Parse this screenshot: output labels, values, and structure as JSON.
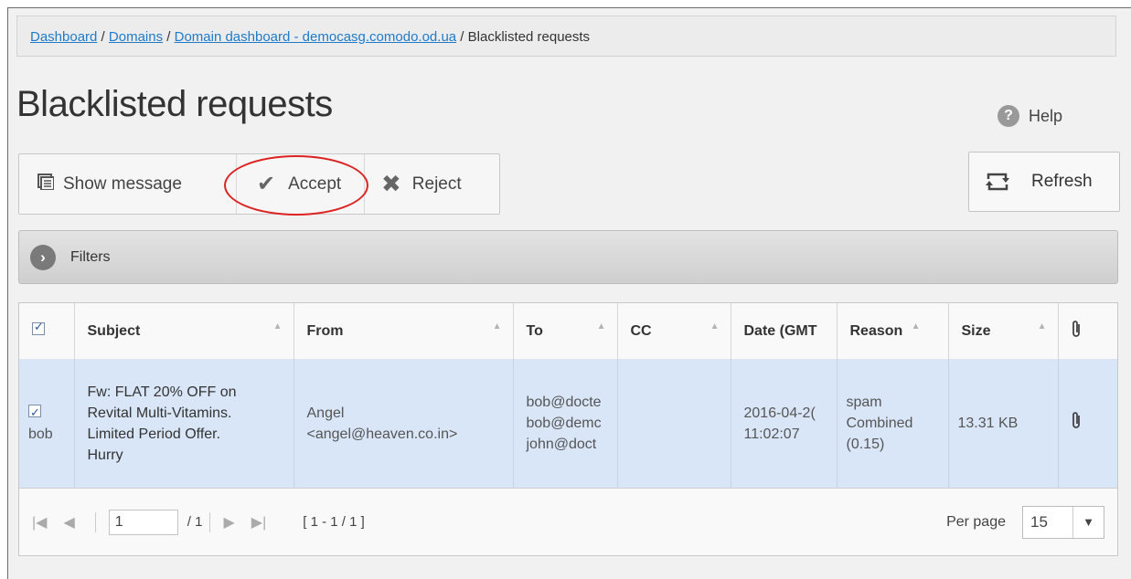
{
  "breadcrumb": {
    "dashboard": "Dashboard",
    "domains": "Domains",
    "domain_dashboard": "Domain dashboard - democasg.comodo.od.ua",
    "current": "Blacklisted requests",
    "separator": " / "
  },
  "page": {
    "title": "Blacklisted requests"
  },
  "help": {
    "icon": "?",
    "label": "Help"
  },
  "toolbar": {
    "show_message": "Show message",
    "accept": "Accept",
    "reject": "Reject",
    "refresh": "Refresh"
  },
  "filters": {
    "label": "Filters"
  },
  "table": {
    "columns": [
      "Subject",
      "From",
      "To",
      "CC",
      "Date (GMT",
      "Reason",
      "Size"
    ],
    "rows": [
      {
        "user": "bob",
        "subject_lines": [
          "Fw: FLAT 20% OFF on",
          "Revital Multi-Vitamins.",
          "Limited Period Offer.",
          "Hurry"
        ],
        "from_lines": [
          "Angel",
          "<angel@heaven.co.in>"
        ],
        "to_lines": [
          "bob@docte",
          "bob@demc",
          "john@doct"
        ],
        "cc": "",
        "date_lines": [
          "2016-04-2(",
          "11:02:07"
        ],
        "reason_lines": [
          "spam",
          "Combined",
          "(0.15)"
        ],
        "size": "13.31 KB"
      }
    ]
  },
  "pager": {
    "page_input": "1",
    "total_pages": "/ 1",
    "range": "[ 1 - 1 / 1 ]",
    "per_page_label": "Per page",
    "per_page_value": "15"
  },
  "colors": {
    "accent_link": "#1f7bc8",
    "selected_row": "#d9e6f7",
    "highlight_ring": "#dd2222"
  }
}
